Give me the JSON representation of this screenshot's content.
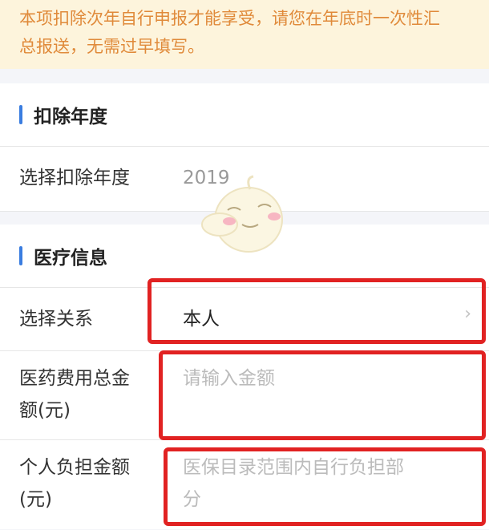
{
  "notice": {
    "line1": "本项扣除次年自行申报才能享受，请您在年底时一次性汇",
    "line2": "总报送，无需过早填写。"
  },
  "deduction_year_section": {
    "title": "扣除年度",
    "row_label": "选择扣除年度",
    "row_value": "2019"
  },
  "medical_section": {
    "title": "医疗信息",
    "relation": {
      "label": "选择关系",
      "value": "本人"
    },
    "total_amount": {
      "label_line1": "医药费用总金",
      "label_line2": "额(元)",
      "placeholder": "请输入金额"
    },
    "personal_amount": {
      "label_line1": "个人负担金额",
      "label_line2": "(元)",
      "placeholder_line1": "医保目录范围内自行负担部",
      "placeholder_line2": "分"
    }
  },
  "colors": {
    "accent": "#3a7de0",
    "notice_text": "#e08a3a",
    "notice_bg": "#fdf4dc",
    "highlight": "#e12222"
  },
  "icons": [
    "chevron-right-icon",
    "mascot-sticker"
  ]
}
